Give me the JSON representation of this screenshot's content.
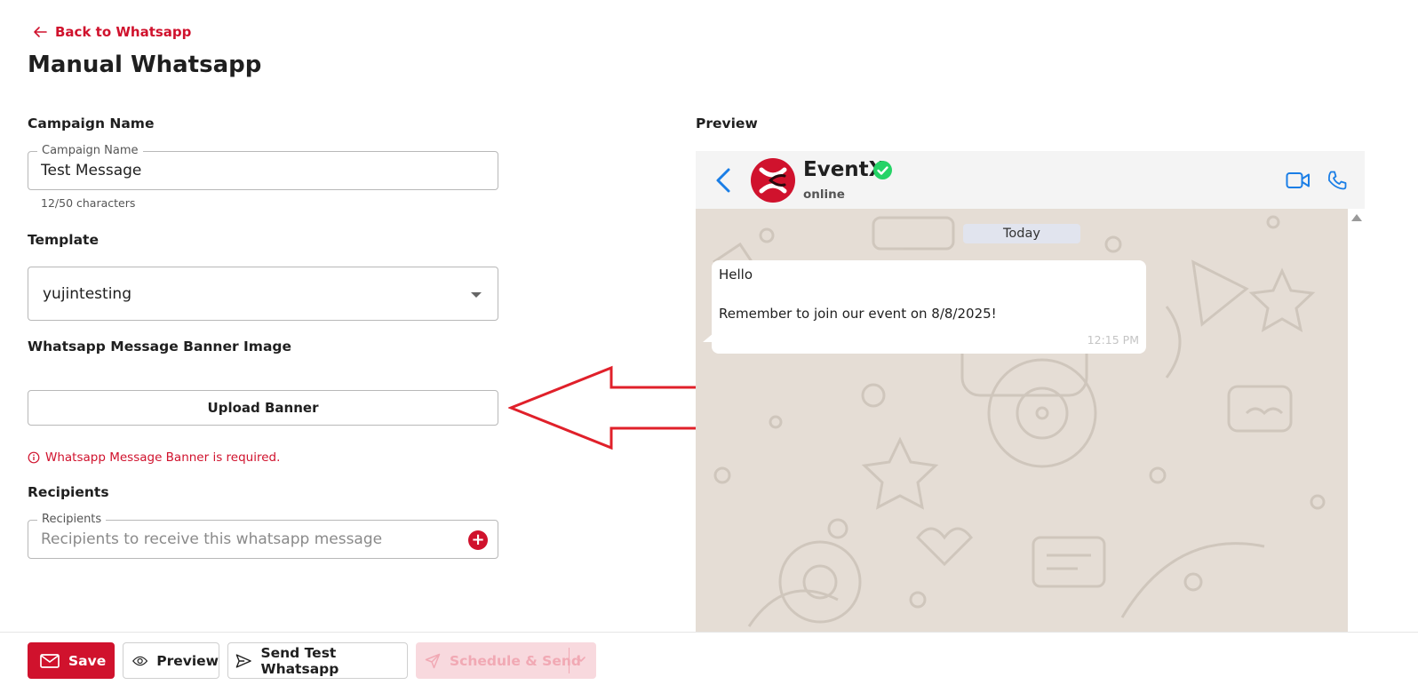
{
  "header": {
    "back_link": "Back to Whatsapp",
    "title": "Manual Whatsapp"
  },
  "form": {
    "campaign": {
      "section_label": "Campaign Name",
      "field_label": "Campaign Name",
      "value": "Test Message",
      "helper": "12/50 characters"
    },
    "template": {
      "section_label": "Template",
      "selected": "yujintesting"
    },
    "banner": {
      "section_label": "Whatsapp Message Banner Image",
      "upload_label": "Upload Banner",
      "error": "Whatsapp Message Banner is required."
    },
    "recipients": {
      "section_label": "Recipients",
      "field_label": "Recipients",
      "placeholder": "Recipients to receive this whatsapp message"
    }
  },
  "preview": {
    "label": "Preview",
    "contact_name": "EventX",
    "contact_status": "online",
    "date_divider": "Today",
    "message": {
      "line1": "Hello",
      "line2": "Remember to join our event on 8/8/2025!",
      "time": "12:15 PM"
    }
  },
  "footer": {
    "save": "Save",
    "preview": "Preview",
    "send_test": "Send Test Whatsapp",
    "schedule": "Schedule & Send"
  },
  "colors": {
    "brand": "#d0122d",
    "whatsapp_green": "#25d366",
    "ios_blue": "#1a7ee6",
    "chat_bg": "#e5ddd5"
  },
  "icons": [
    "arrow-left-icon",
    "chevron-down-icon",
    "info-circle-icon",
    "plus-circle-icon",
    "back-chevron-icon",
    "verified-check-icon",
    "video-call-icon",
    "phone-call-icon",
    "mail-icon",
    "eye-icon",
    "send-icon"
  ]
}
